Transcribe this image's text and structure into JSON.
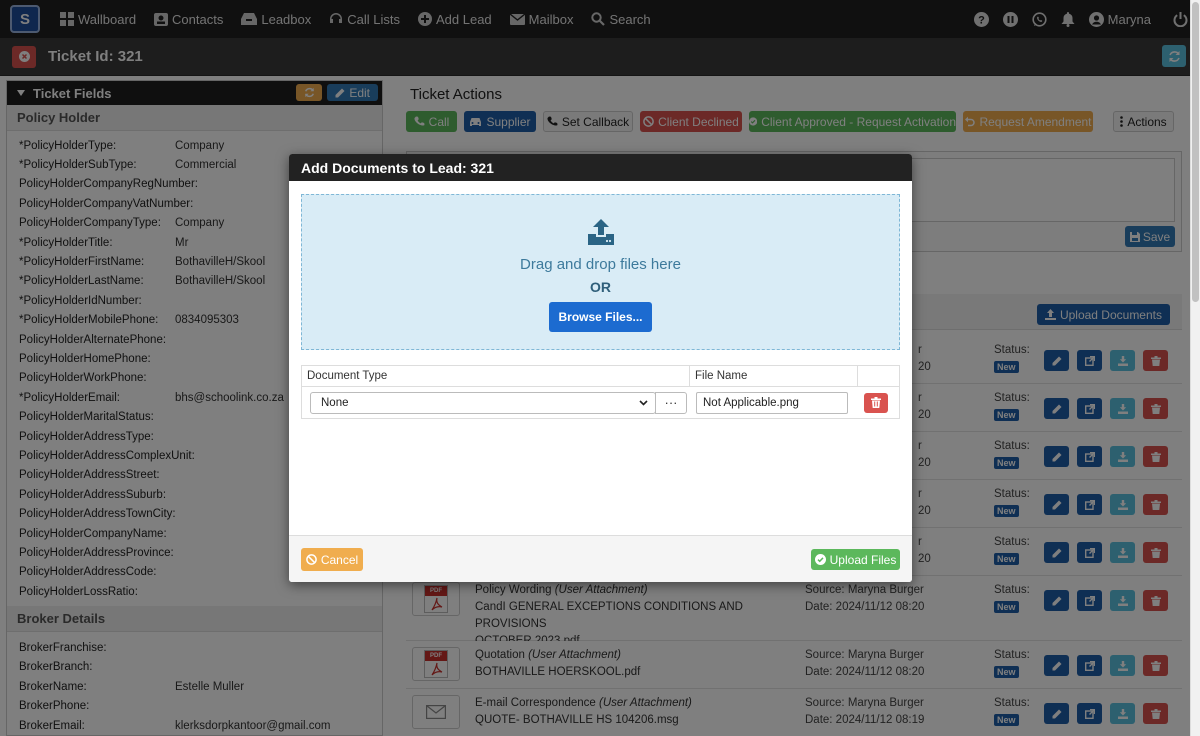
{
  "nav": {
    "logo": "S",
    "items": [
      "Wallboard",
      "Contacts",
      "Leadbox",
      "Call Lists",
      "Add Lead",
      "Mailbox",
      "Search"
    ],
    "user": "Maryna"
  },
  "ticket": {
    "title": "Ticket Id: 321"
  },
  "fields": {
    "header": "Ticket Fields",
    "edit_label": "Edit",
    "policy_section": "Policy Holder",
    "policy": [
      {
        "label": "*PolicyHolderType:",
        "value": "Company"
      },
      {
        "label": "*PolicyHolderSubType:",
        "value": "Commercial"
      },
      {
        "label": "PolicyHolderCompanyRegNumber:",
        "value": ""
      },
      {
        "label": "PolicyHolderCompanyVatNumber:",
        "value": ""
      },
      {
        "label": "PolicyHolderCompanyType:",
        "value": "Company"
      },
      {
        "label": "*PolicyHolderTitle:",
        "value": "Mr"
      },
      {
        "label": "*PolicyHolderFirstName:",
        "value": "BothavilleH/Skool"
      },
      {
        "label": "*PolicyHolderLastName:",
        "value": "BothavilleH/Skool"
      },
      {
        "label": "*PolicyHolderIdNumber:",
        "value": ""
      },
      {
        "label": "*PolicyHolderMobilePhone:",
        "value": "0834095303"
      },
      {
        "label": "PolicyHolderAlternatePhone:",
        "value": ""
      },
      {
        "label": "PolicyHolderHomePhone:",
        "value": ""
      },
      {
        "label": "PolicyHolderWorkPhone:",
        "value": ""
      },
      {
        "label": "*PolicyHolderEmail:",
        "value": "bhs@schoolink.co.za"
      },
      {
        "label": "PolicyHolderMaritalStatus:",
        "value": ""
      },
      {
        "label": "PolicyHolderAddressType:",
        "value": ""
      },
      {
        "label": "PolicyHolderAddressComplexUnit:",
        "value": ""
      },
      {
        "label": "PolicyHolderAddressStreet:",
        "value": ""
      },
      {
        "label": "PolicyHolderAddressSuburb:",
        "value": ""
      },
      {
        "label": "PolicyHolderAddressTownCity:",
        "value": ""
      },
      {
        "label": "PolicyHolderCompanyName:",
        "value": ""
      },
      {
        "label": "PolicyHolderAddressProvince:",
        "value": ""
      },
      {
        "label": "PolicyHolderAddressCode:",
        "value": ""
      },
      {
        "label": "PolicyHolderLossRatio:",
        "value": ""
      }
    ],
    "broker_section": "Broker Details",
    "broker": [
      {
        "label": "BrokerFranchise:",
        "value": ""
      },
      {
        "label": "BrokerBranch:",
        "value": ""
      },
      {
        "label": "BrokerName:",
        "value": "Estelle Muller"
      },
      {
        "label": "BrokerPhone:",
        "value": ""
      },
      {
        "label": "BrokerEmail:",
        "value": "klerksdorpkantoor@gmail.com"
      }
    ]
  },
  "actions": {
    "title": "Ticket Actions",
    "call": "Call",
    "supplier": "Supplier",
    "set_callback": "Set Callback",
    "client_declined": "Client Declined",
    "client_approved": "Client Approved - Request Activation",
    "request_amendment": "Request Amendment",
    "actions_menu": "Actions",
    "save": "Save"
  },
  "documents": {
    "upload_button": "Upload Documents",
    "partial_rows": [
      {
        "src_tail": "r",
        "date_tail": "20",
        "status": "Status:",
        "badge": "New"
      },
      {
        "src_tail": "r",
        "date_tail": "20",
        "status": "Status:",
        "badge": "New"
      },
      {
        "src_tail": "r",
        "date_tail": "20",
        "status": "Status:",
        "badge": "New"
      },
      {
        "src_tail": "r",
        "date_tail": "20",
        "status": "Status:",
        "badge": "New"
      },
      {
        "src_tail": "r",
        "date_tail": "20",
        "status": "Status:",
        "badge": "New"
      }
    ],
    "rows": [
      {
        "title": "Policy Wording",
        "kind": "(User Attachment)",
        "file_line1": "CandI GENERAL EXCEPTIONS CONDITIONS AND PROVISIONS",
        "file_line2": "OCTOBER 2023.pdf",
        "source": "Source: Maryna Burger",
        "date": "Date: 2024/11/12 08:20",
        "status": "Status:",
        "badge": "New",
        "icon": "pdf-icon"
      },
      {
        "title": "Quotation",
        "kind": "(User Attachment)",
        "file_line1": "BOTHAVILLE HOERSKOOL.pdf",
        "file_line2": "",
        "source": "Source: Maryna Burger",
        "date": "Date: 2024/11/12 08:20",
        "status": "Status:",
        "badge": "New",
        "icon": "pdf-icon"
      },
      {
        "title": "E-mail Correspondence",
        "kind": "(User Attachment)",
        "file_line1": "QUOTE- BOTHAVILLE HS 104206.msg",
        "file_line2": "",
        "source": "Source: Maryna Burger",
        "date": "Date: 2024/11/12 08:19",
        "status": "Status:",
        "badge": "New",
        "icon": "envelope-icon"
      }
    ]
  },
  "modal": {
    "title": "Add Documents to Lead: 321",
    "drag_text": "Drag and drop files here",
    "or_text": "OR",
    "browse": "Browse Files...",
    "col_doc_type": "Document Type",
    "col_file_name": "File Name",
    "doc_type_value": "None",
    "dots": "···",
    "file_name_value": "Not Applicable.png",
    "cancel": "Cancel",
    "upload": "Upload Files"
  },
  "colors": {
    "nav_bg": "#212121",
    "primary": "#337ab7",
    "success": "#5cb85c",
    "danger": "#d9534f",
    "warning": "#f0ad4e",
    "info": "#5bc0de"
  }
}
